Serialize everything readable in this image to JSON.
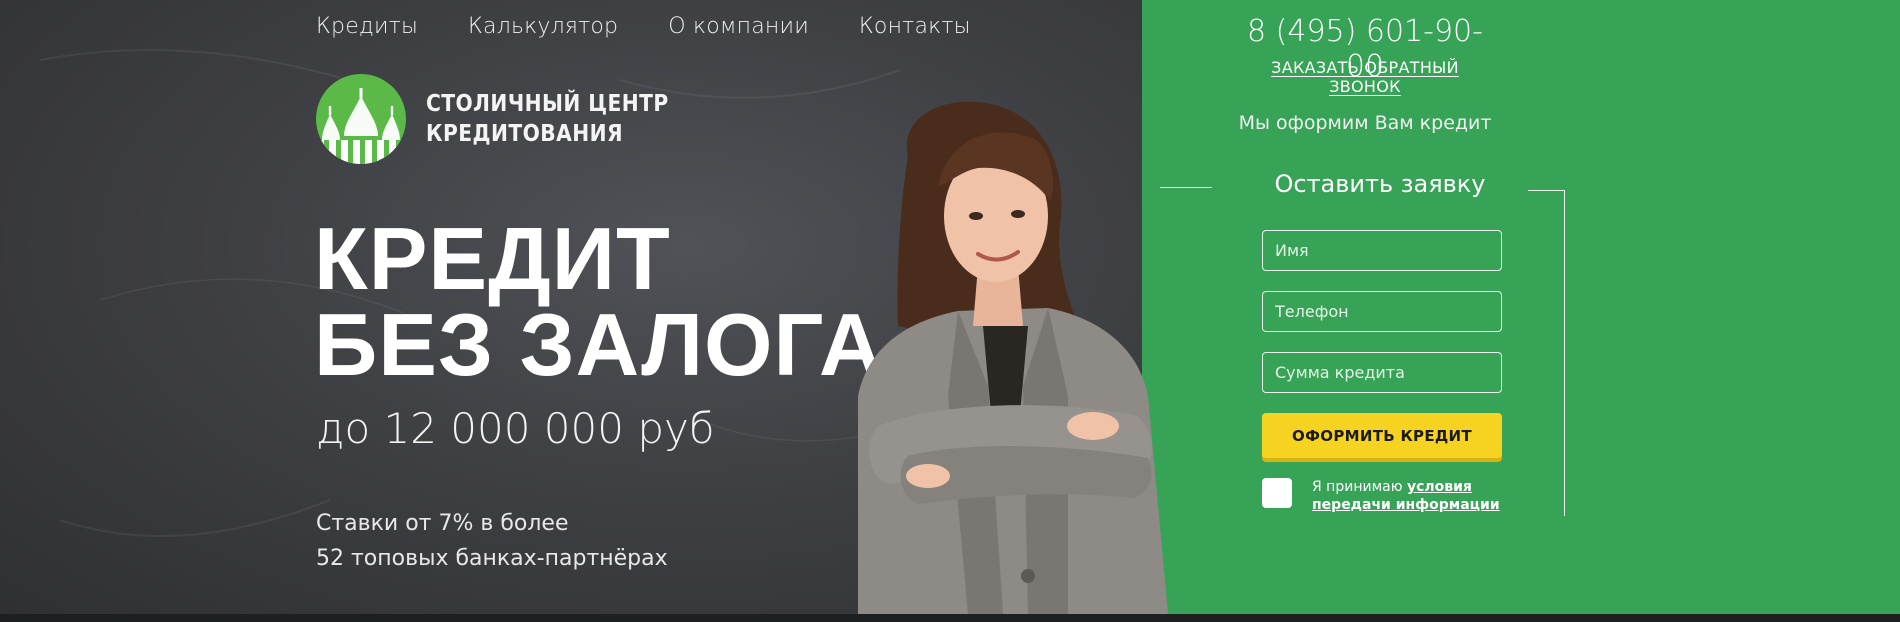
{
  "nav": {
    "items": [
      {
        "label": "Кредиты"
      },
      {
        "label": "Калькулятор"
      },
      {
        "label": "О компании"
      },
      {
        "label": "Контакты"
      }
    ]
  },
  "logo": {
    "line1": "СТОЛИЧНЫЙ ЦЕНТР",
    "line2": "КРЕДИТОВАНИЯ"
  },
  "hero": {
    "headline_line1": "КРЕДИТ",
    "headline_line2": "БЕЗ ЗАЛОГА",
    "subheadline": "до 12 000 000 руб",
    "rates_line1": "Ставки от 7% в более",
    "rates_line2": "52 топовых банках-партнёрах"
  },
  "contact": {
    "phone": "8 (495) 601-90-00",
    "callback": "ЗАКАЗАТЬ ОБРАТНЫЙ ЗВОНОК",
    "tagline": "Мы оформим Вам кредит"
  },
  "form": {
    "title": "Оставить заявку",
    "name_placeholder": "Имя",
    "phone_placeholder": "Телефон",
    "sum_placeholder": "Сумма кредита",
    "submit_label": "ОФОРМИТЬ КРЕДИТ",
    "agree_prefix": "Я принимаю ",
    "agree_link": "условия передачи информации"
  },
  "colors": {
    "dark_bg": "#3f4044",
    "green_bg": "#36a356",
    "accent_yellow": "#f6d320",
    "logo_green": "#5bb947"
  }
}
